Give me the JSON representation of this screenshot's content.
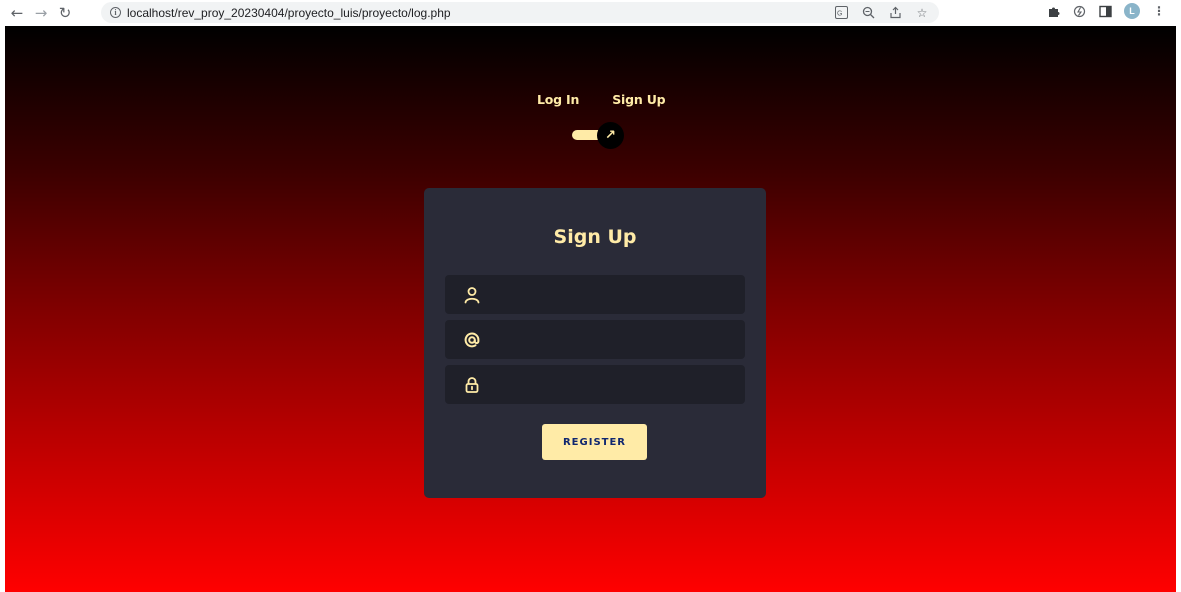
{
  "browser": {
    "url": "localhost/rev_proy_20230404/proyecto_luis/proyecto/log.php",
    "profile_initial": "L"
  },
  "tabs": {
    "login_label": "Log In",
    "signup_label": "Sign Up"
  },
  "toggle": {
    "checked": true,
    "icon": "arrow-up-right-icon"
  },
  "card": {
    "title": "Sign Up",
    "fields": [
      {
        "icon": "user-icon",
        "value": "",
        "placeholder": ""
      },
      {
        "icon": "at-icon",
        "value": "",
        "placeholder": ""
      },
      {
        "icon": "lock-icon",
        "value": "",
        "placeholder": ""
      }
    ],
    "submit_label": "REGISTER"
  },
  "colors": {
    "accent": "#ffeba7",
    "card_bg": "#2a2b38",
    "field_bg": "#1f2029",
    "gradient_top": "#000000",
    "gradient_bottom": "#ff0000"
  }
}
